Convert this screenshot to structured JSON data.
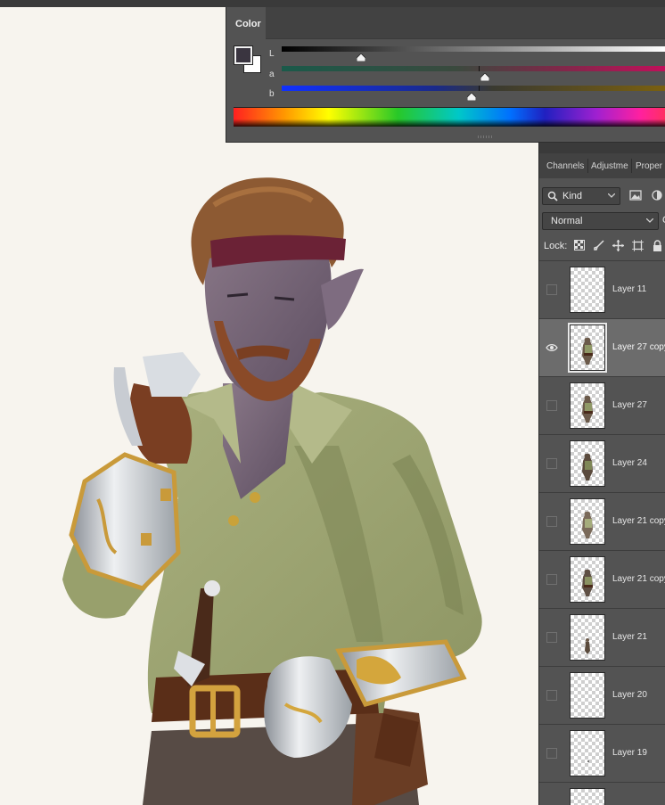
{
  "color_panel": {
    "tab_label": "Color",
    "sliders": [
      {
        "label": "L",
        "thumb_position": 0.21,
        "gradient": [
          "#000000",
          "#ffffff"
        ]
      },
      {
        "label": "a",
        "thumb_position": 0.53,
        "gradient": [
          "#1a5a4a",
          "#c0105a"
        ]
      },
      {
        "label": "b",
        "thumb_position": 0.51,
        "gradient": [
          "#1030ff",
          "#7a6010"
        ]
      }
    ],
    "foreground_color": "#3a3540",
    "background_color": "#ffffff"
  },
  "layers_panel": {
    "tabs": [
      "Channels",
      "Adjustme",
      "Proper"
    ],
    "filter_kind": "Kind",
    "blend_mode": "Normal",
    "opacity_stub": "O",
    "lock_label": "Lock:",
    "lock_icons": [
      "lock-transparent-pixels-icon",
      "lock-image-pixels-icon",
      "lock-position-icon",
      "lock-artboard-icon",
      "lock-all-icon"
    ],
    "layers": [
      {
        "name": "Layer 11",
        "visible": false,
        "selected": false,
        "thumb": "empty"
      },
      {
        "name": "Layer 27 copy",
        "visible": true,
        "selected": true,
        "thumb": "figure"
      },
      {
        "name": "Layer 27",
        "visible": false,
        "selected": false,
        "thumb": "figure"
      },
      {
        "name": "Layer 24",
        "visible": false,
        "selected": false,
        "thumb": "figure"
      },
      {
        "name": "Layer 21 copy",
        "visible": false,
        "selected": false,
        "thumb": "figure"
      },
      {
        "name": "Layer 21 copy",
        "visible": false,
        "selected": false,
        "thumb": "figure"
      },
      {
        "name": "Layer 21",
        "visible": false,
        "selected": false,
        "thumb": "small"
      },
      {
        "name": "Layer 20",
        "visible": false,
        "selected": false,
        "thumb": "empty"
      },
      {
        "name": "Layer 19",
        "visible": false,
        "selected": false,
        "thumb": "dot"
      },
      {
        "name": "",
        "visible": false,
        "selected": false,
        "thumb": "empty"
      }
    ]
  }
}
